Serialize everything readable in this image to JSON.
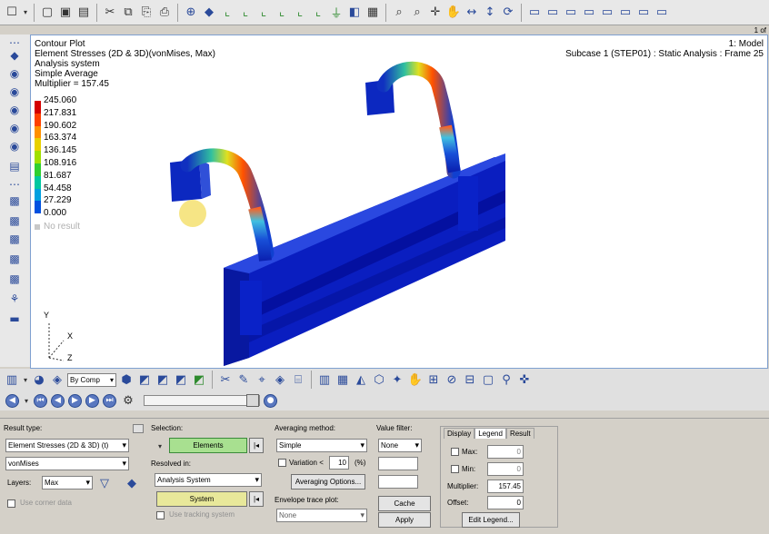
{
  "top_toolbar": {
    "icons": [
      "select-icon",
      "undo-icon",
      "redo-icon",
      "save-icon",
      "cut-icon",
      "copy-icon",
      "paste-icon",
      "zoom-icon",
      "rotate-icon",
      "view-axes-icon",
      "mask-icon",
      "color-icon",
      "fit-icon",
      "pan-icon",
      "flip-icon",
      "window-icon"
    ]
  },
  "page_indicator": "1 of",
  "viewport": {
    "info_left": [
      "Contour Plot",
      "Element Stresses (2D & 3D)(vonMises, Max)",
      "Analysis system",
      "Simple Average",
      "Multiplier = 157.45"
    ],
    "info_right": [
      "1: Model",
      "Subcase 1 (STEP01) : Static Analysis : Frame 25"
    ],
    "legend": {
      "values": [
        "245.060",
        "217.831",
        "190.602",
        "163.374",
        "136.145",
        "108.916",
        "81.687",
        "54.458",
        "27.229",
        "0.000"
      ],
      "colors": [
        "#d40000",
        "#ff4000",
        "#ff9000",
        "#e8d000",
        "#a0e000",
        "#30d030",
        "#00c8a0",
        "#00a0e0",
        "#0050e0",
        "#0010b0"
      ],
      "no_result": "No result"
    },
    "triad": {
      "y": "Y",
      "x": "X",
      "z": "Z"
    }
  },
  "bottom_toolbar": {
    "by_comp": "By Comp"
  },
  "panel": {
    "result_type_label": "Result type:",
    "result_type_value": "Element Stresses (2D & 3D) (t)",
    "component_value": "vonMises",
    "layers_label": "Layers:",
    "layers_value": "Max",
    "use_corner_data": "Use corner data",
    "selection_label": "Selection:",
    "selection_button": "Elements",
    "resolved_label": "Resolved in:",
    "resolved_value": "Analysis System",
    "system_button": "System",
    "use_tracking": "Use tracking system",
    "averaging_label": "Averaging method:",
    "averaging_value": "Simple",
    "variation_label": "Variation <",
    "variation_value": "10",
    "variation_unit": "(%)",
    "averaging_options": "Averaging Options...",
    "envelope_label": "Envelope trace plot:",
    "envelope_value": "None",
    "value_filter_label": "Value filter:",
    "value_filter_value": "None",
    "cache_button": "Cache",
    "apply_button": "Apply",
    "tabs": [
      "Display",
      "Legend",
      "Result"
    ],
    "max_label": "Max:",
    "max_value": "0",
    "min_label": "Min:",
    "min_value": "0",
    "multiplier_label": "Multiplier:",
    "multiplier_value": "157.45",
    "offset_label": "Offset:",
    "offset_value": "0",
    "edit_legend": "Edit Legend..."
  }
}
